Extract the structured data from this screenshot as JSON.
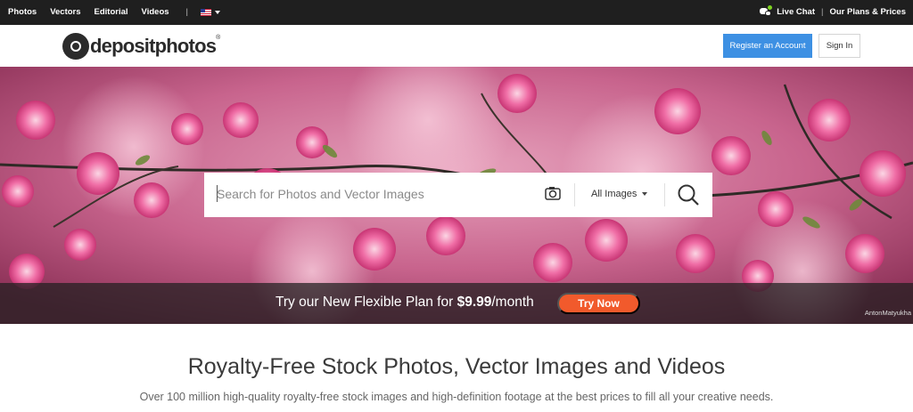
{
  "topbar": {
    "nav": [
      "Photos",
      "Vectors",
      "Editorial",
      "Videos"
    ],
    "separator": "|",
    "live_chat": "Live Chat",
    "pipe": "|",
    "plans": "Our Plans & Prices"
  },
  "header": {
    "logo_text": "depositphotos",
    "logo_reg": "®",
    "register_label": "Register an Account",
    "signin_label": "Sign In",
    "accent_color": "#3d90e3"
  },
  "search": {
    "placeholder": "Search for Photos and Vector Images",
    "filter_label": "All Images"
  },
  "promo": {
    "prefix": "Try our New Flexible Plan for ",
    "price": "$9.99",
    "suffix": "/month",
    "cta_label": "Try Now",
    "cta_color": "#f15a2c",
    "credit": "AntonMatyukha"
  },
  "main": {
    "headline": "Royalty-Free Stock Photos, Vector Images and Videos",
    "subline": "Over 100 million high-quality royalty-free stock images and high-definition footage at the best prices to fill all your creative needs."
  }
}
